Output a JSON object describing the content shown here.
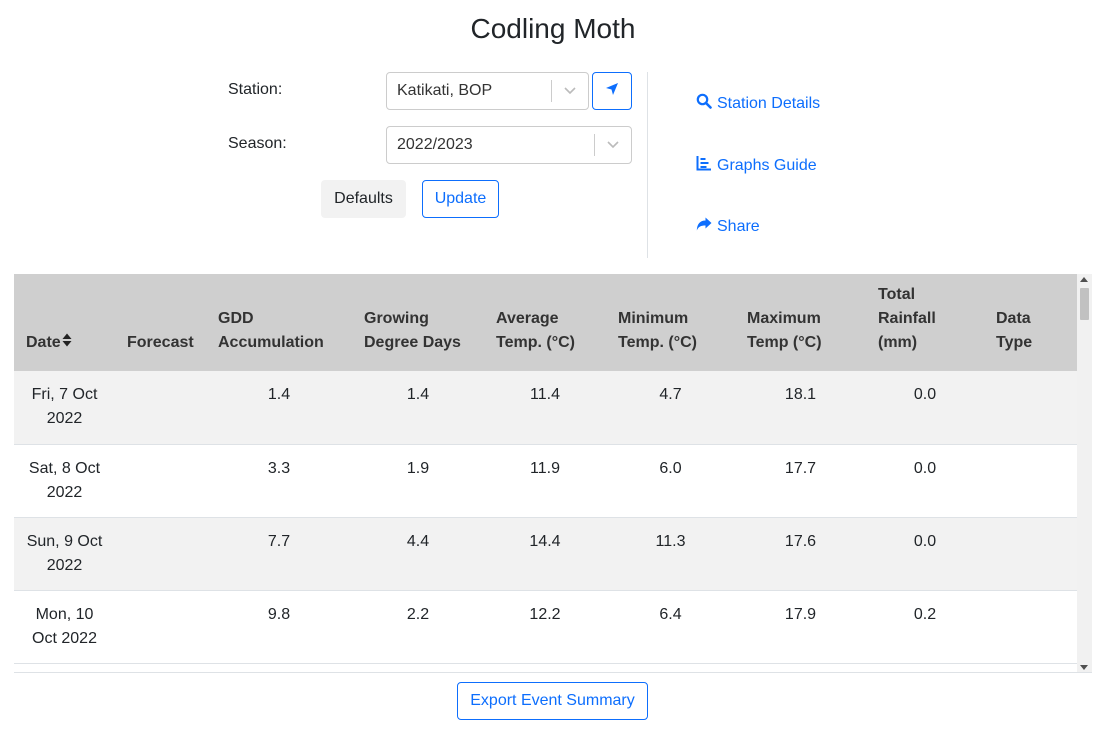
{
  "title": "Codling Moth",
  "form": {
    "station_label": "Station:",
    "station_value": "Katikati, BOP",
    "season_label": "Season:",
    "season_value": "2022/2023",
    "defaults_label": "Defaults",
    "update_label": "Update"
  },
  "side_links": {
    "station_details": "Station Details",
    "graphs_guide": "Graphs Guide",
    "share": "Share"
  },
  "table": {
    "columns": [
      [
        "Date"
      ],
      [
        "Forecast"
      ],
      [
        "GDD",
        "Accumulation"
      ],
      [
        "Growing",
        "Degree Days"
      ],
      [
        "Average",
        "Temp. (°C)"
      ],
      [
        "Minimum",
        "Temp. (°C)"
      ],
      [
        "Maximum",
        "Temp (°C)"
      ],
      [
        "Total",
        "Rainfall",
        "(mm)"
      ],
      [
        "Data",
        "Type"
      ]
    ],
    "rows": [
      {
        "date": [
          "Fri, 7 Oct",
          "2022"
        ],
        "forecast": "",
        "gdd_acc": "1.4",
        "gdd": "1.4",
        "avg": "11.4",
        "min": "4.7",
        "max": "18.1",
        "rain": "0.0",
        "type": ""
      },
      {
        "date": [
          "Sat, 8 Oct",
          "2022"
        ],
        "forecast": "",
        "gdd_acc": "3.3",
        "gdd": "1.9",
        "avg": "11.9",
        "min": "6.0",
        "max": "17.7",
        "rain": "0.0",
        "type": ""
      },
      {
        "date": [
          "Sun, 9 Oct",
          "2022"
        ],
        "forecast": "",
        "gdd_acc": "7.7",
        "gdd": "4.4",
        "avg": "14.4",
        "min": "11.3",
        "max": "17.6",
        "rain": "0.0",
        "type": ""
      },
      {
        "date": [
          "Mon, 10",
          "Oct 2022"
        ],
        "forecast": "",
        "gdd_acc": "9.8",
        "gdd": "2.2",
        "avg": "12.2",
        "min": "6.4",
        "max": "17.9",
        "rain": "0.2",
        "type": ""
      }
    ]
  },
  "export_label": "Export Event Summary",
  "colors": {
    "accent": "#0d6efd",
    "header_bg": "#cfcfcf",
    "row_striped": "#f2f2f2"
  },
  "icons": {
    "locate": "location-arrow-icon",
    "station_details": "search-icon",
    "graphs_guide": "chart-icon",
    "share": "share-icon",
    "sort": "sort-icon",
    "dropdown": "chevron-down-icon"
  }
}
